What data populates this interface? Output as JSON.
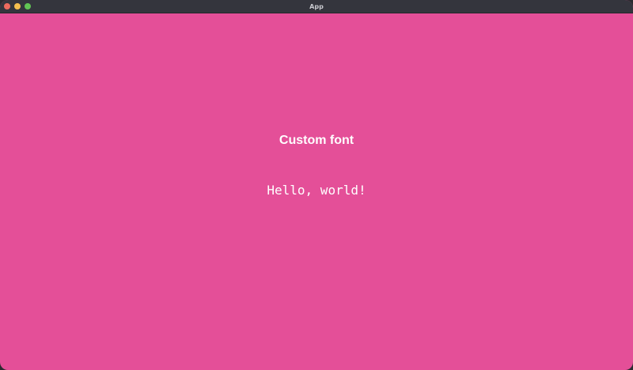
{
  "window": {
    "title": "App",
    "controls": {
      "close_color": "#ed6a5e",
      "minimize_color": "#f5bf4f",
      "maximize_color": "#61c554"
    },
    "background": "#e44f98"
  },
  "content": {
    "heading": "Custom font",
    "body_text": "Hello, world!"
  }
}
